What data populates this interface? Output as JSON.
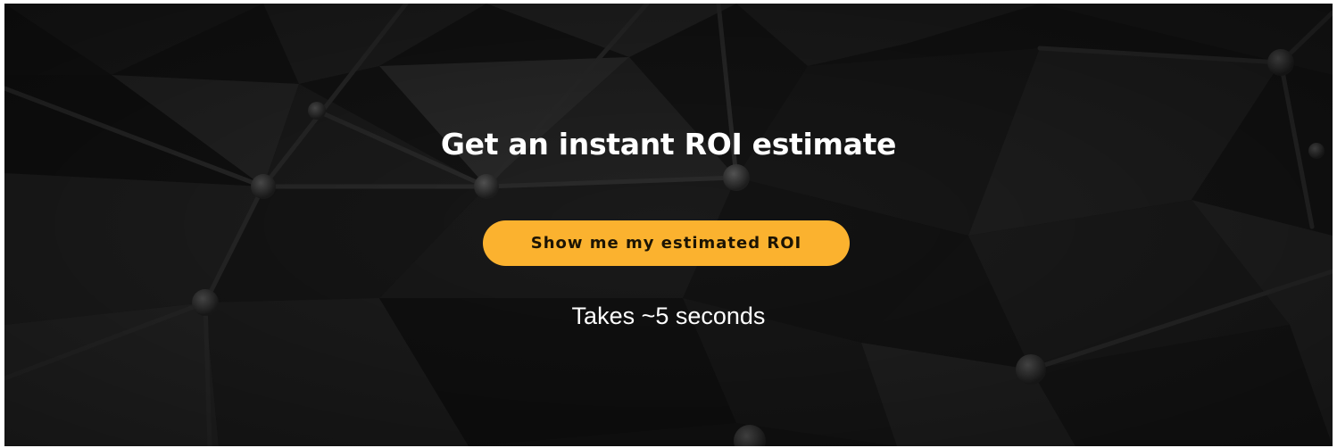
{
  "banner": {
    "headline": "Get an instant ROI estimate",
    "cta_label": "Show me my estimated ROI",
    "subtext": "Takes ~5 seconds",
    "background_image": "dark-polygonal-network-pattern"
  },
  "colors": {
    "background": "#141414",
    "cta_fill": "#fbb22f",
    "cta_text": "#1c1404",
    "headline_text": "#ffffff"
  }
}
